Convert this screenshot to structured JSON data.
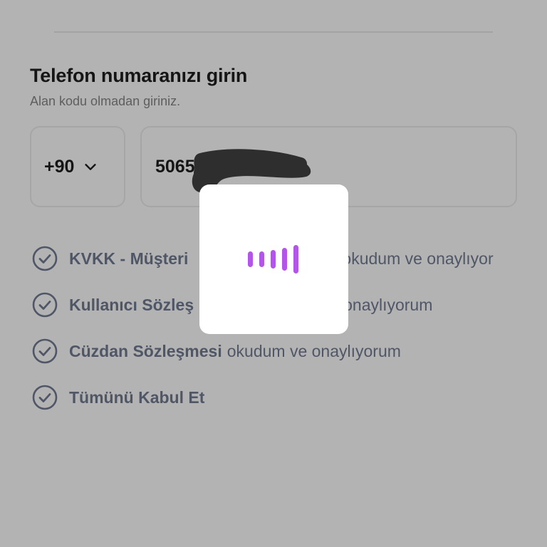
{
  "login_form": {
    "title": "Telefon numaranızı girin",
    "subtitle": "Alan kodu olmadan giriniz.",
    "country_code": "+90",
    "phone_value_visible": "5065"
  },
  "consents": [
    {
      "strong": "KVKK - Müşteri",
      "rest": "okudum ve onaylıyor"
    },
    {
      "strong": "Kullanıcı Sözleş",
      "rest": "onaylıyorum"
    },
    {
      "strong": "Cüzdan Sözleşmesi",
      "rest": "okudum ve onaylıyorum"
    },
    {
      "strong": "Tümünü Kabul Et",
      "rest": ""
    }
  ],
  "colors": {
    "overlay_bg": "#b3b3b3",
    "loader_accent": "#b455ea",
    "check_icon": "#4f5666"
  }
}
